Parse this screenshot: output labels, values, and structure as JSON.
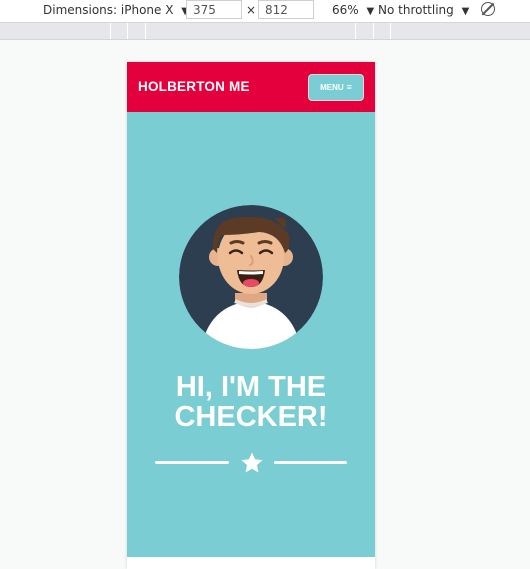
{
  "devtools": {
    "dimensions_label": "Dimensions: iPhone X",
    "width_value": "375",
    "times": "×",
    "height_value": "812",
    "zoom": "66%",
    "throttling": "No throttling",
    "caret": "▼"
  },
  "site": {
    "logo": "HOLBERTON ME",
    "menu_label": "MENU",
    "menu_icon": "≡",
    "hero_title_line1": "HI, I'M THE",
    "hero_title_line2": "CHECKER!"
  },
  "colors": {
    "header": "#e3003d",
    "hero": "#7acdd3",
    "avatar_bg": "#2c3e50"
  },
  "icons": [
    "rotate-icon",
    "star-icon",
    "hamburger-icon",
    "avatar-icon"
  ]
}
